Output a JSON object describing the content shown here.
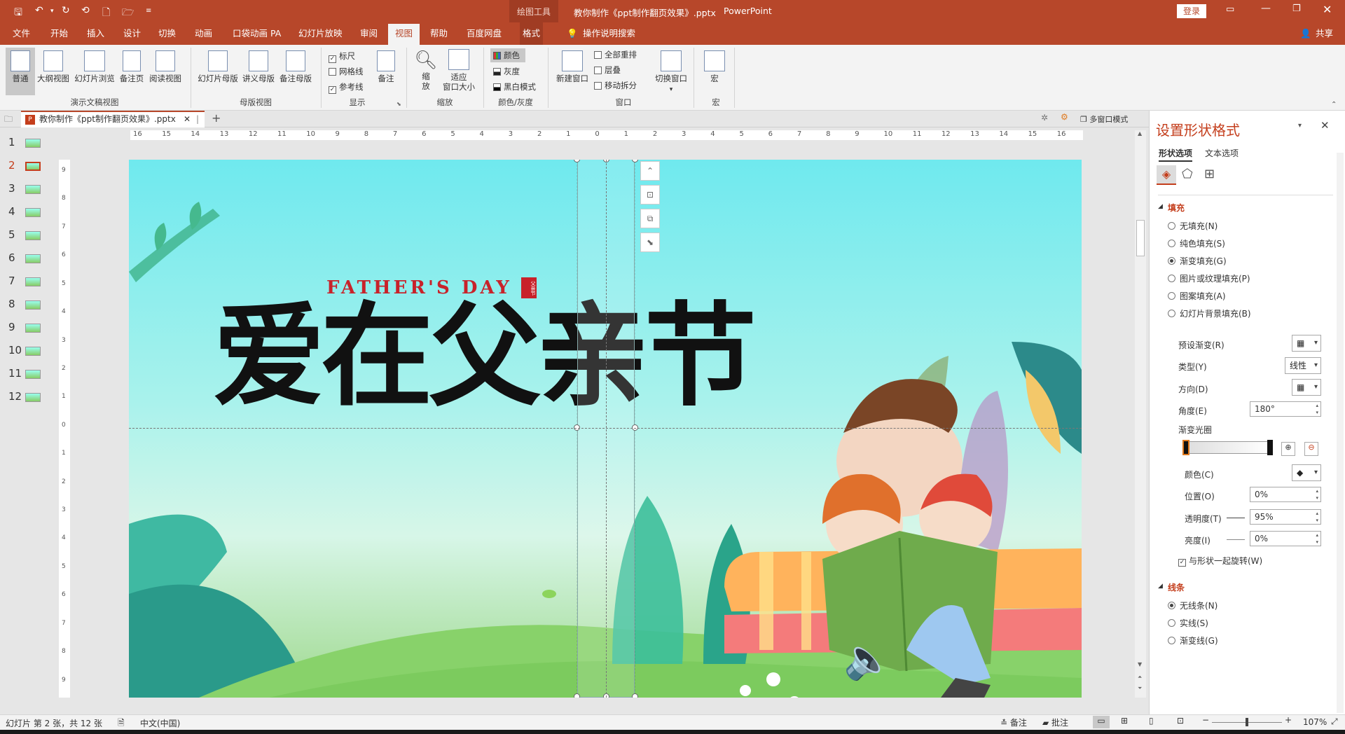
{
  "titlebar": {
    "context_tool": "绘图工具",
    "document_title": "教你制作《ppt制作翻页效果》.pptx",
    "app_name": "PowerPoint",
    "login_label": "登录"
  },
  "tabs": [
    "文件",
    "开始",
    "插入",
    "设计",
    "切换",
    "动画",
    "口袋动画 PA",
    "幻灯片放映",
    "审阅",
    "视图",
    "帮助",
    "百度网盘",
    "格式"
  ],
  "active_tab": "视图",
  "tell_me": "操作说明搜索",
  "share": "共享",
  "ribbon": {
    "views": {
      "label": "演示文稿视图",
      "items": [
        "普通",
        "大纲视图",
        "幻灯片浏览",
        "备注页",
        "阅读视图"
      ]
    },
    "master": {
      "label": "母版视图",
      "items": [
        "幻灯片母版",
        "讲义母版",
        "备注母版"
      ]
    },
    "show": {
      "label": "显示",
      "ruler": "标尺",
      "gridlines": "网格线",
      "guides": "参考线",
      "notes": "备注"
    },
    "zoom": {
      "label": "缩放",
      "zoom1": "缩",
      "zoom2": "放",
      "fit1": "适应",
      "fit2": "窗口大小"
    },
    "color": {
      "label": "颜色/灰度",
      "color": "颜色",
      "gray": "灰度",
      "bw": "黑白模式"
    },
    "window": {
      "label": "窗口",
      "new_window": "新建窗口",
      "arrange_all": "全部重排",
      "cascade": "层叠",
      "move_split": "移动拆分",
      "switch1": "切换窗口"
    },
    "macro": {
      "label": "宏",
      "item": "宏"
    }
  },
  "doc_tab": "教你制作《ppt制作翻页效果》.pptx",
  "multi_window": "多窗口模式",
  "thumbnails": [
    1,
    2,
    3,
    4,
    5,
    6,
    7,
    8,
    9,
    10,
    11,
    12
  ],
  "active_slide": 2,
  "slide": {
    "english_title": "FATHER'S DAY",
    "chinese_title": "爱在父亲节",
    "seal": "父亲节"
  },
  "panel": {
    "title": "设置形状格式",
    "tab_shape": "形状选项",
    "tab_text": "文本选项",
    "fill_header": "填充",
    "fill_options": [
      "无填充(N)",
      "纯色填充(S)",
      "渐变填充(G)",
      "图片或纹理填充(P)",
      "图案填充(A)",
      "幻灯片背景填充(B)"
    ],
    "fill_selected": "渐变填充(G)",
    "preset": "预设渐变(R)",
    "type_label": "类型(Y)",
    "type_value": "线性",
    "direction": "方向(D)",
    "angle_label": "角度(E)",
    "angle_value": "180°",
    "stops_label": "渐变光圈",
    "color_label": "颜色(C)",
    "position_label": "位置(O)",
    "position_value": "0%",
    "transparency_label": "透明度(T)",
    "transparency_value": "95%",
    "brightness_label": "亮度(I)",
    "brightness_value": "0%",
    "rotate_with_shape": "与形状一起旋转(W)",
    "line_header": "线条",
    "line_options": [
      "无线条(N)",
      "实线(S)",
      "渐变线(G)"
    ],
    "line_selected": "无线条(N)"
  },
  "status": {
    "slide_info": "幻灯片 第 2 张，共 12 张",
    "language": "中文(中国)",
    "notes": "备注",
    "comments": "批注",
    "zoom": "107%"
  },
  "ruler_h": [
    "16",
    "15",
    "14",
    "13",
    "12",
    "11",
    "10",
    "9",
    "8",
    "7",
    "6",
    "5",
    "4",
    "3",
    "2",
    "1",
    "0",
    "1",
    "2",
    "3",
    "4",
    "5",
    "6",
    "7",
    "8",
    "9",
    "10",
    "11",
    "12",
    "13",
    "14",
    "15",
    "16"
  ],
  "ruler_v": [
    "9",
    "8",
    "7",
    "6",
    "5",
    "4",
    "3",
    "2",
    "1",
    "0",
    "1",
    "2",
    "3",
    "4",
    "5",
    "6",
    "7",
    "8",
    "9"
  ],
  "colors": {
    "accent": "#b7472a",
    "panel_title": "#c43e1c"
  }
}
